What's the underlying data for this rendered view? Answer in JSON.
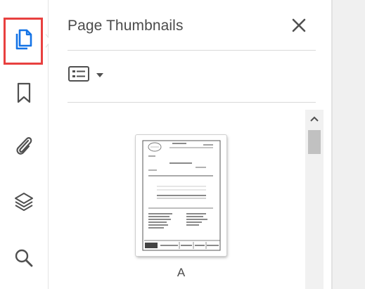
{
  "panel": {
    "title": "Page Thumbnails",
    "close_label": "close",
    "view_options_label": "thumbnail options"
  },
  "rail": {
    "items": [
      {
        "icon": "page-thumbnails-icon",
        "active": true
      },
      {
        "icon": "bookmark-icon",
        "active": false
      },
      {
        "icon": "paperclip-icon",
        "active": false
      },
      {
        "icon": "layers-icon",
        "active": false
      },
      {
        "icon": "search-icon",
        "active": false
      }
    ]
  },
  "thumbnails": [
    {
      "label": "A"
    }
  ],
  "colors": {
    "accent": "#1473e6",
    "highlight_box": "#e8403f",
    "icon_gray": "#505050",
    "title_text": "#4b4b4b"
  }
}
